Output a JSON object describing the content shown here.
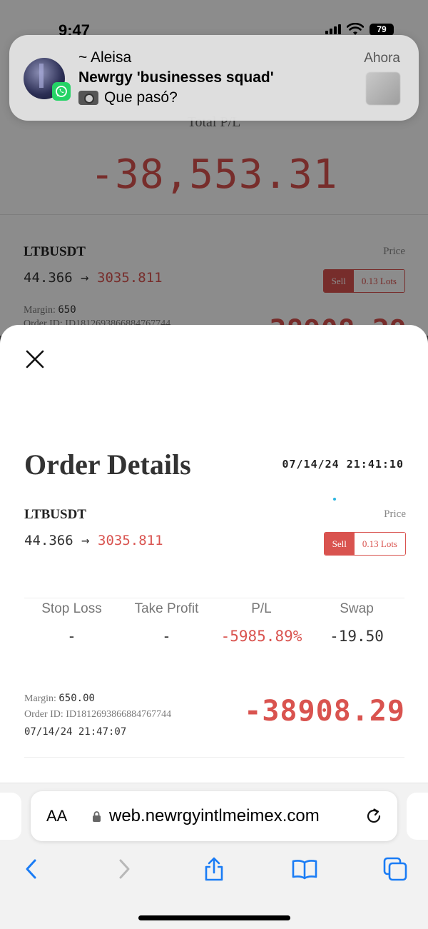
{
  "status_bar": {
    "time": "9:47",
    "battery": "79"
  },
  "notification": {
    "sender": "~ Aleisa",
    "group": "Newrgy 'businesses squad'",
    "message": "Que pasó?",
    "time": "Ahora",
    "app_badge_icon": "whatsapp-icon",
    "attachment_icon": "camera-icon"
  },
  "background_page": {
    "total_label": "Total P/L",
    "total_value": "-38,553.31",
    "order": {
      "symbol": "LTBUSDT",
      "price_label": "Price",
      "open_price": "44.366",
      "arrow": "→",
      "current_price": "3035.811",
      "sell_label": "Sell",
      "lots_label": "0.13 Lots",
      "margin_label": "Margin:",
      "margin_value": "650",
      "order_id_partial": "Order ID: ID1812693866884767744",
      "pl_partial": "-38908.29"
    }
  },
  "order_details": {
    "close_icon": "close-icon",
    "title": "Order Details",
    "datetime": "07/14/24 21:41:10",
    "symbol": "LTBUSDT",
    "price_label": "Price",
    "open_price": "44.366",
    "arrow": "→",
    "current_price": "3035.811",
    "sell_label": "Sell",
    "lots_label": "0.13 Lots",
    "stats": {
      "headers": [
        "Stop Loss",
        "Take Profit",
        "P/L",
        "Swap"
      ],
      "values": [
        "-",
        "-",
        "-5985.89%",
        "-19.50"
      ]
    },
    "margin_label": "Margin:",
    "margin_value": "650.00",
    "order_id": "Order ID: ID1812693866884767744",
    "close_time": "07/14/24 21:47:07",
    "pl_value": "-38908.29"
  },
  "browser": {
    "text_size_label": "AA",
    "url": "web.newrgyintlmeimex.com",
    "toolbar_icons": [
      "back-icon",
      "forward-icon",
      "share-icon",
      "bookmarks-icon",
      "tabs-icon"
    ]
  },
  "colors": {
    "loss_red": "#d9534f",
    "ios_blue": "#1a7cf5",
    "whatsapp_green": "#25d366"
  }
}
